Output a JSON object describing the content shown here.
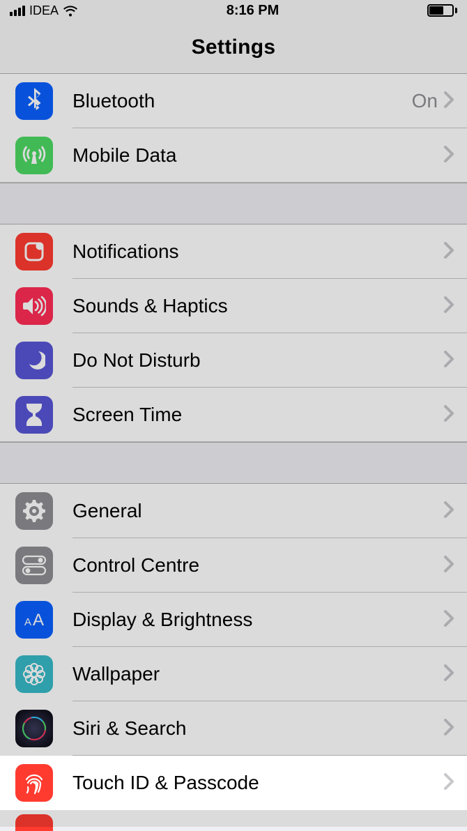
{
  "statusbar": {
    "carrier": "IDEA",
    "time": "8:16 PM"
  },
  "header": {
    "title": "Settings"
  },
  "groups": [
    {
      "rows": [
        {
          "id": "bluetooth",
          "label": "Bluetooth",
          "value": "On",
          "icon": "bluetooth",
          "color": "#0a60ff"
        },
        {
          "id": "mobile-data",
          "label": "Mobile Data",
          "value": "",
          "icon": "antenna",
          "color": "#4cd964"
        }
      ]
    },
    {
      "rows": [
        {
          "id": "notifications",
          "label": "Notifications",
          "value": "",
          "icon": "notifications",
          "color": "#ff3b30"
        },
        {
          "id": "sounds",
          "label": "Sounds & Haptics",
          "value": "",
          "icon": "speaker",
          "color": "#ff2d55"
        },
        {
          "id": "dnd",
          "label": "Do Not Disturb",
          "value": "",
          "icon": "moon",
          "color": "#5856d6"
        },
        {
          "id": "screen-time",
          "label": "Screen Time",
          "value": "",
          "icon": "hourglass",
          "color": "#5856d6"
        }
      ]
    },
    {
      "rows": [
        {
          "id": "general",
          "label": "General",
          "value": "",
          "icon": "gear",
          "color": "#8e8e93"
        },
        {
          "id": "controlcentre",
          "label": "Control Centre",
          "value": "",
          "icon": "toggles",
          "color": "#8e8e93"
        },
        {
          "id": "display",
          "label": "Display & Brightness",
          "value": "",
          "icon": "aa",
          "color": "#0a60ff"
        },
        {
          "id": "wallpaper",
          "label": "Wallpaper",
          "value": "",
          "icon": "flower",
          "color": "#37bac7"
        },
        {
          "id": "siri",
          "label": "Siri & Search",
          "value": "",
          "icon": "siri",
          "color": "#1c1c1e"
        },
        {
          "id": "touchid",
          "label": "Touch ID & Passcode",
          "value": "",
          "icon": "fingerprint",
          "color": "#ff3b30",
          "highlight": true
        }
      ]
    }
  ]
}
